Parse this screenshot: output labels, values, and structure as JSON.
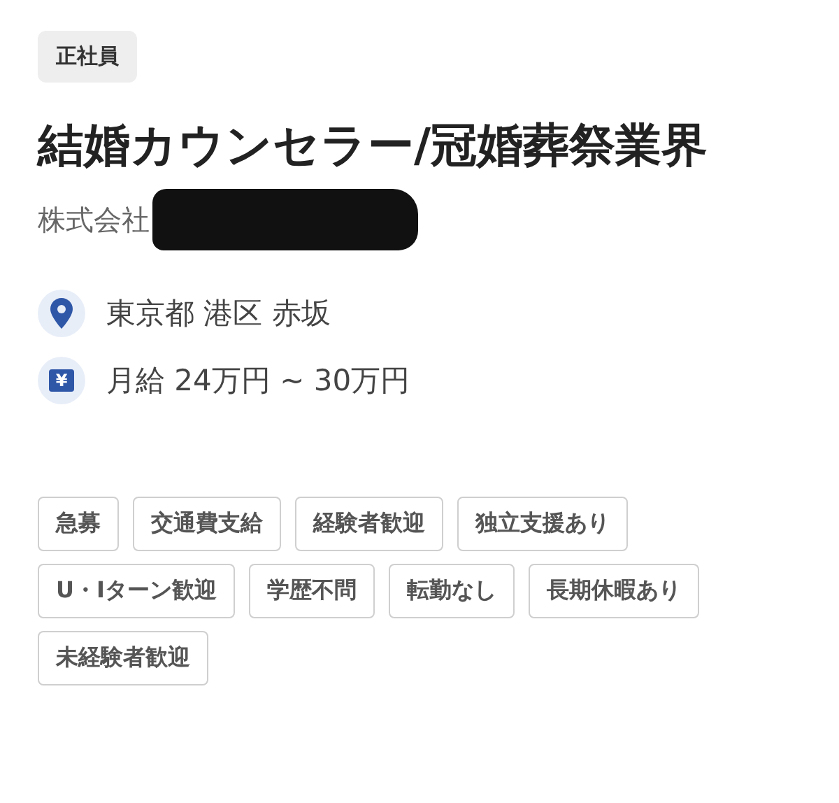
{
  "employment_badge": "正社員",
  "job_title": "結婚カウンセラー/冠婚葬祭業界",
  "company": {
    "name": "株式会社",
    "redacted": true
  },
  "details": [
    {
      "kind": "location",
      "text": "東京都 港区 赤坂"
    },
    {
      "kind": "salary",
      "icon_text": "¥",
      "text": "月給 24万円 ~ 30万円"
    }
  ],
  "tags": [
    "急募",
    "交通費支給",
    "経験者歓迎",
    "独立支援あり",
    "U・Iターン歓迎",
    "学歴不問",
    "転勤なし",
    "長期休暇あり",
    "未経験者歓迎"
  ]
}
